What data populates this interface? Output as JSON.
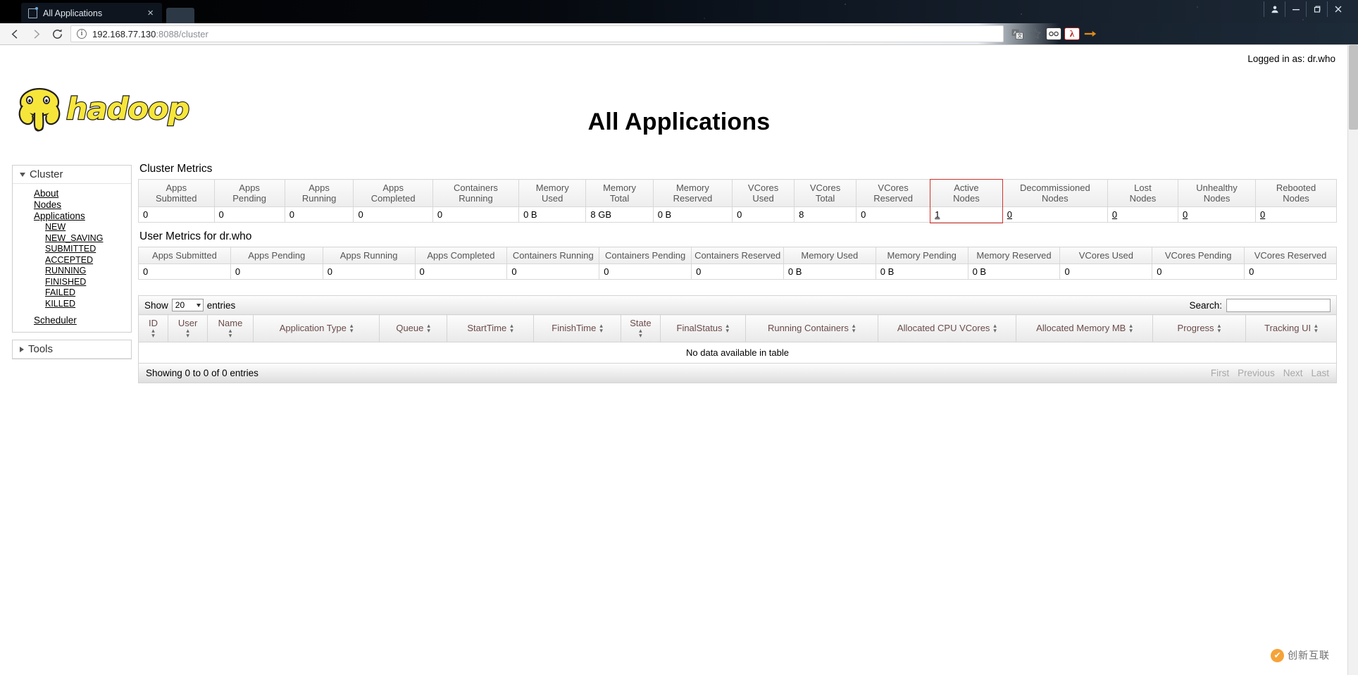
{
  "browser": {
    "tab_title": "All Applications",
    "tab_close_label": "×",
    "url_host": "192.168.77.130",
    "url_rest": ":8088/cluster",
    "back_icon": "back-arrow-icon",
    "forward_icon": "forward-arrow-icon",
    "reload_icon": "reload-icon",
    "translate_icon": "translate-icon",
    "bookmark_icon": "star-icon",
    "minimize_label": "–",
    "maximize_label": "❐",
    "close_label": "✕"
  },
  "page": {
    "logged_in_as": "Logged in as: dr.who",
    "title": "All Applications",
    "logo_text": "hadoop"
  },
  "sidebar": {
    "cluster": {
      "label": "Cluster",
      "links": [
        {
          "label": "About"
        },
        {
          "label": "Nodes"
        },
        {
          "label": "Applications"
        }
      ],
      "app_states": [
        {
          "label": "NEW"
        },
        {
          "label": "NEW_SAVING"
        },
        {
          "label": "SUBMITTED"
        },
        {
          "label": "ACCEPTED"
        },
        {
          "label": "RUNNING"
        },
        {
          "label": "FINISHED"
        },
        {
          "label": "FAILED"
        },
        {
          "label": "KILLED"
        }
      ],
      "scheduler": {
        "label": "Scheduler"
      }
    },
    "tools": {
      "label": "Tools"
    }
  },
  "cluster_metrics": {
    "title": "Cluster Metrics",
    "columns": [
      {
        "line1": "Apps",
        "line2": "Submitted"
      },
      {
        "line1": "Apps",
        "line2": "Pending"
      },
      {
        "line1": "Apps",
        "line2": "Running"
      },
      {
        "line1": "Apps",
        "line2": "Completed"
      },
      {
        "line1": "Containers",
        "line2": "Running"
      },
      {
        "line1": "Memory",
        "line2": "Used"
      },
      {
        "line1": "Memory",
        "line2": "Total"
      },
      {
        "line1": "Memory",
        "line2": "Reserved"
      },
      {
        "line1": "VCores",
        "line2": "Used"
      },
      {
        "line1": "VCores",
        "line2": "Total"
      },
      {
        "line1": "VCores",
        "line2": "Reserved"
      },
      {
        "line1": "Active",
        "line2": "Nodes"
      },
      {
        "line1": "Decommissioned",
        "line2": "Nodes"
      },
      {
        "line1": "Lost",
        "line2": "Nodes"
      },
      {
        "line1": "Unhealthy",
        "line2": "Nodes"
      },
      {
        "line1": "Rebooted",
        "line2": "Nodes"
      }
    ],
    "values": [
      "0",
      "0",
      "0",
      "0",
      "0",
      "0 B",
      "8 GB",
      "0 B",
      "0",
      "8",
      "0",
      "1",
      "0",
      "0",
      "0",
      "0"
    ],
    "link_value_indexes": [
      11,
      12,
      13,
      14,
      15
    ],
    "highlight_column": "Active Nodes",
    "highlight_color": "#d0342c"
  },
  "user_metrics": {
    "title": "User Metrics for dr.who",
    "columns": [
      "Apps Submitted",
      "Apps Pending",
      "Apps Running",
      "Apps Completed",
      "Containers Running",
      "Containers Pending",
      "Containers Reserved",
      "Memory Used",
      "Memory Pending",
      "Memory Reserved",
      "VCores Used",
      "VCores Pending",
      "VCores Reserved"
    ],
    "values": [
      "0",
      "0",
      "0",
      "0",
      "0",
      "0",
      "0",
      "0 B",
      "0 B",
      "0 B",
      "0",
      "0",
      "0"
    ]
  },
  "apps_table": {
    "show_label": "Show",
    "entries_label": "entries",
    "page_length": "20",
    "search_label": "Search:",
    "search_value": "",
    "search_placeholder": "",
    "columns": [
      {
        "label": "ID",
        "sortable": true,
        "wrap": true
      },
      {
        "label": "User",
        "sortable": true,
        "wrap": true
      },
      {
        "label": "Name",
        "sortable": true,
        "wrap": true
      },
      {
        "label": "Application Type",
        "sortable": true,
        "wrap": false
      },
      {
        "label": "Queue",
        "sortable": true,
        "wrap": false
      },
      {
        "label": "StartTime",
        "sortable": true,
        "wrap": false
      },
      {
        "label": "FinishTime",
        "sortable": true,
        "wrap": false
      },
      {
        "label": "State",
        "sortable": true,
        "wrap": true
      },
      {
        "label": "FinalStatus",
        "sortable": true,
        "wrap": false
      },
      {
        "label": "Running Containers",
        "sortable": true,
        "wrap": false
      },
      {
        "label": "Allocated CPU VCores",
        "sortable": true,
        "wrap": false
      },
      {
        "label": "Allocated Memory MB",
        "sortable": true,
        "wrap": false
      },
      {
        "label": "Progress",
        "sortable": true,
        "wrap": false
      },
      {
        "label": "Tracking UI",
        "sortable": true,
        "wrap": false
      }
    ],
    "empty_message": "No data available in table",
    "info_text": "Showing 0 to 0 of 0 entries",
    "paging": [
      {
        "label": "First"
      },
      {
        "label": "Previous"
      },
      {
        "label": "Next"
      },
      {
        "label": "Last"
      }
    ]
  },
  "watermark": {
    "text": "创新互联"
  }
}
